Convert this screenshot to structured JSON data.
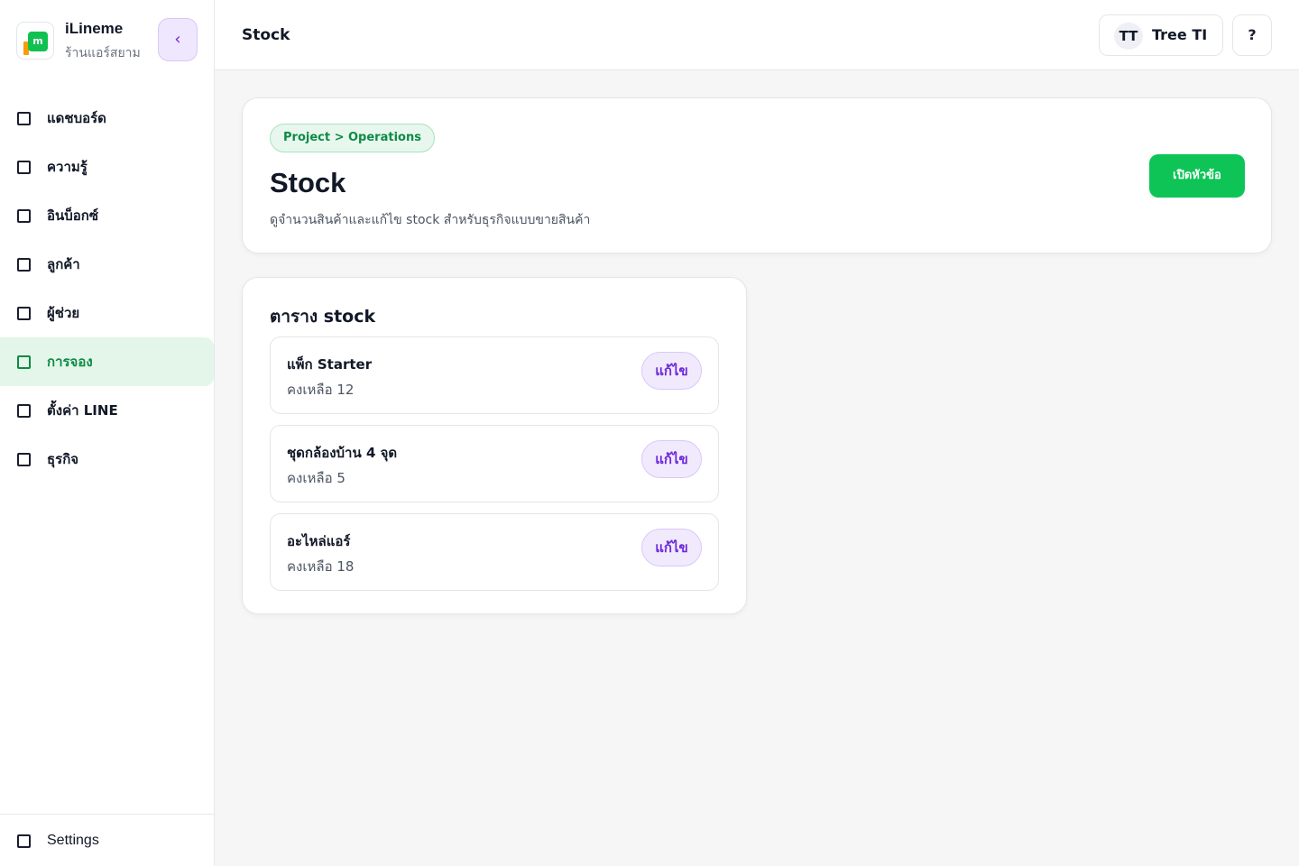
{
  "sidebar": {
    "brand_name": "iLineme",
    "brand_sub": "ร้านแอร์สยาม",
    "logo_letter": "m",
    "collapse_label": "‹",
    "items": [
      {
        "label": "แดชบอร์ด",
        "active": false
      },
      {
        "label": "ความรู้",
        "active": false
      },
      {
        "label": "อินบ็อกซ์",
        "active": false
      },
      {
        "label": "ลูกค้า",
        "active": false
      },
      {
        "label": "ผู้ช่วย",
        "active": false
      },
      {
        "label": "การจอง",
        "active": true
      },
      {
        "label": "ตั้งค่า LINE",
        "active": false
      },
      {
        "label": "ธุรกิจ",
        "active": false
      }
    ],
    "footer_label": "Settings"
  },
  "header": {
    "title": "Stock",
    "user_initials": "TT",
    "user_name": "Tree TI",
    "help_label": "?"
  },
  "hero": {
    "breadcrumb": "Project > Operations",
    "title": "Stock",
    "subtitle": "ดูจำนวนสินค้าและแก้ไข stock สำหรับธุรกิจแบบขายสินค้า",
    "open_button": "เปิดหัวข้อ"
  },
  "stock": {
    "title": "ตาราง stock",
    "items": [
      {
        "name": "แพ็ก Starter",
        "qty": "คงเหลือ 12",
        "edit": "แก้ไข"
      },
      {
        "name": "ชุดกล้องบ้าน 4 จุด",
        "qty": "คงเหลือ 5",
        "edit": "แก้ไข"
      },
      {
        "name": "อะไหล่แอร์",
        "qty": "คงเหลือ 18",
        "edit": "แก้ไข"
      }
    ]
  },
  "colors": {
    "accent_green": "#0fc456",
    "active_nav_bg": "#e3f6e9",
    "purple_button": "#6d28d9",
    "logo_orange": "#f59e0b"
  }
}
